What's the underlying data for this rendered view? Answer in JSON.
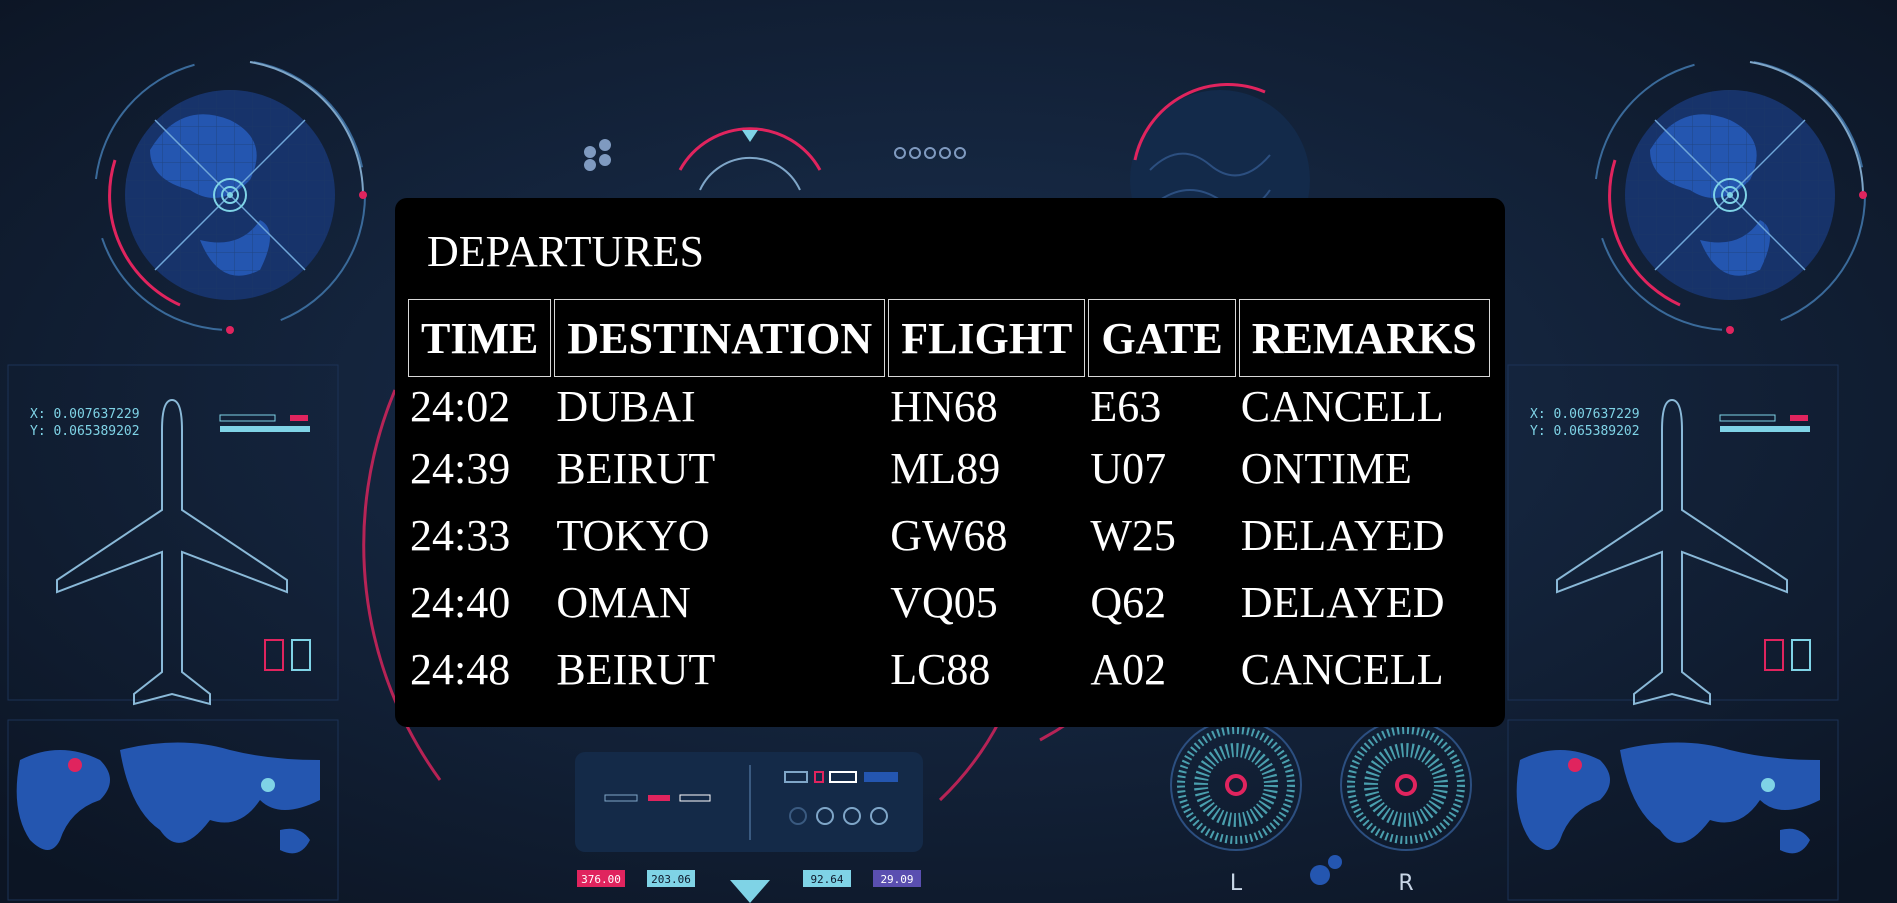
{
  "board": {
    "title": "DEPARTURES",
    "columns": [
      "TIME",
      "DESTINATION",
      "FLIGHT",
      "GATE",
      "REMARKS"
    ],
    "rows": [
      [
        "24:02",
        "DUBAI",
        "HN68",
        "E63",
        "CANCELL"
      ],
      [
        "24:39",
        "BEIRUT",
        "ML89",
        "U07",
        "ONTIME"
      ],
      [
        "24:33",
        "TOKYO",
        "GW68",
        "W25",
        "DELAYED"
      ],
      [
        "24:40",
        "OMAN",
        "VQ05",
        "Q62",
        "DELAYED"
      ],
      [
        "24:48",
        "BEIRUT",
        "LC88",
        "A02",
        "CANCELL"
      ]
    ]
  },
  "hud": {
    "coord_x": "X: 0.007637229",
    "coord_y": "Y: 0.065389202",
    "engine_left": "L",
    "engine_right": "R",
    "readouts": [
      "376.00",
      "203.06",
      "92.64",
      "29.09"
    ]
  },
  "colors": {
    "background": "#0f1a2c",
    "accent_pink": "#e0245e",
    "accent_cyan": "#7fd3e6",
    "accent_blue": "#2a5fc0",
    "board": "#000000"
  }
}
